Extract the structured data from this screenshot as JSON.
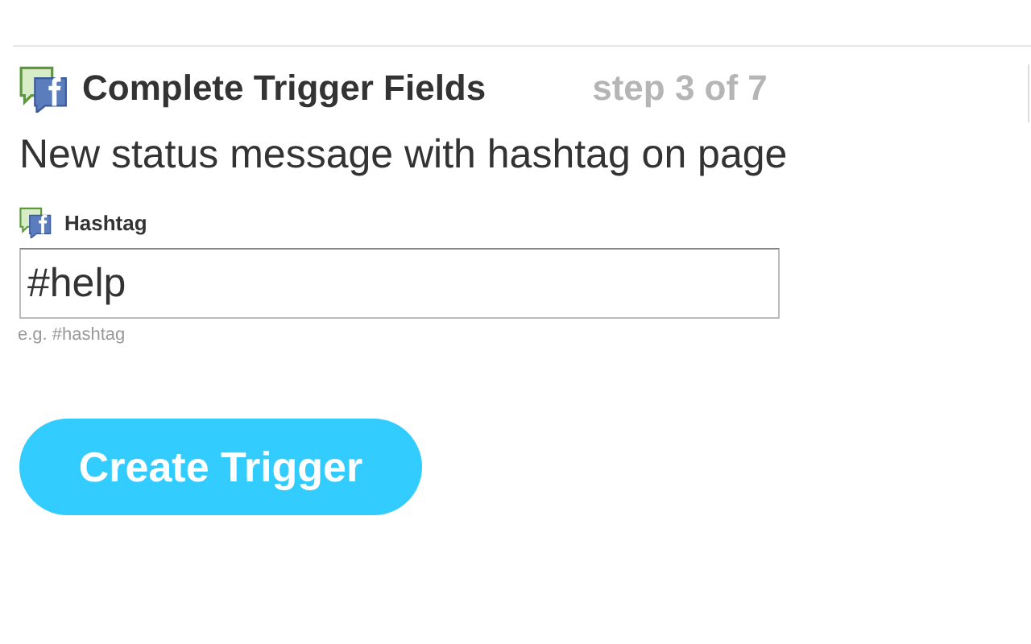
{
  "header": {
    "title": "Complete Trigger Fields",
    "step": "step 3 of 7"
  },
  "trigger_description": "New status message with hashtag on page",
  "field": {
    "label": "Hashtag",
    "value": "#help",
    "hint": "e.g. #hashtag"
  },
  "button": {
    "label": "Create Trigger"
  }
}
